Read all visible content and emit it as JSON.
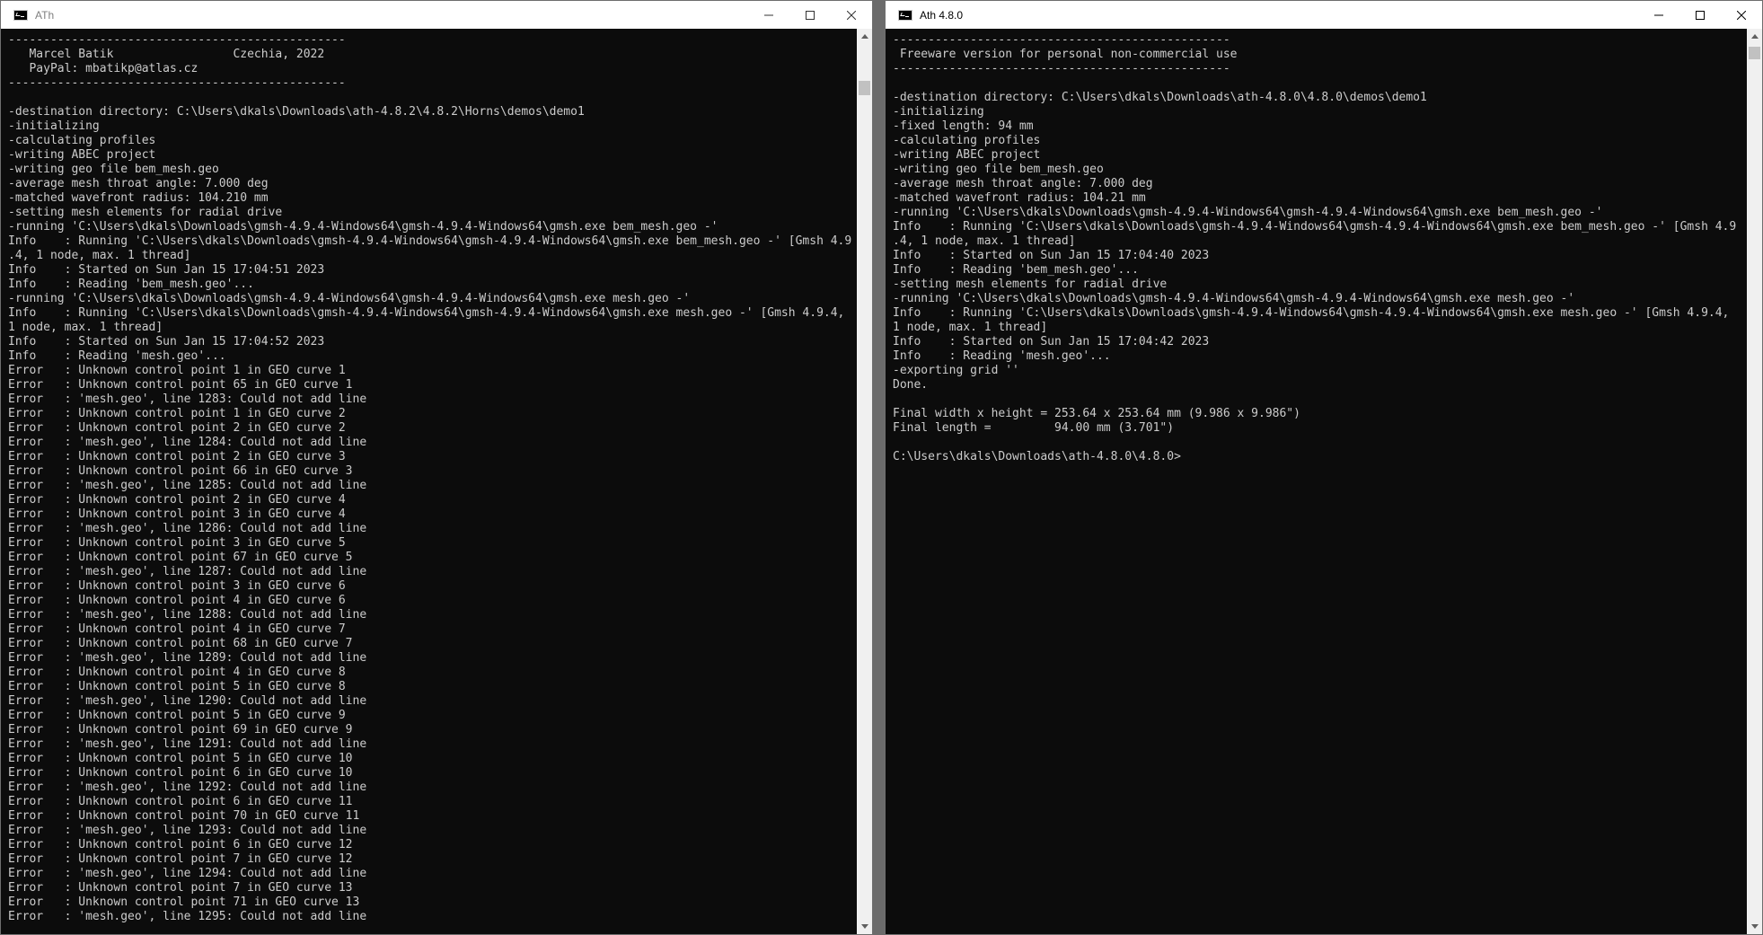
{
  "left_window": {
    "title": "ATh",
    "lines": [
      "------------------------------------------------",
      "   Marcel Batik                 Czechia, 2022",
      "   PayPal: mbatikp@atlas.cz",
      "------------------------------------------------",
      "",
      "-destination directory: C:\\Users\\dkals\\Downloads\\ath-4.8.2\\4.8.2\\Horns\\demos\\demo1",
      "-initializing",
      "-calculating profiles",
      "-writing ABEC project",
      "-writing geo file bem_mesh.geo",
      "-average mesh throat angle: 7.000 deg",
      "-matched wavefront radius: 104.210 mm",
      "-setting mesh elements for radial drive",
      "-running 'C:\\Users\\dkals\\Downloads\\gmsh-4.9.4-Windows64\\gmsh-4.9.4-Windows64\\gmsh.exe bem_mesh.geo -'",
      "Info    : Running 'C:\\Users\\dkals\\Downloads\\gmsh-4.9.4-Windows64\\gmsh-4.9.4-Windows64\\gmsh.exe bem_mesh.geo -' [Gmsh 4.9",
      ".4, 1 node, max. 1 thread]",
      "Info    : Started on Sun Jan 15 17:04:51 2023",
      "Info    : Reading 'bem_mesh.geo'...",
      "-running 'C:\\Users\\dkals\\Downloads\\gmsh-4.9.4-Windows64\\gmsh-4.9.4-Windows64\\gmsh.exe mesh.geo -'",
      "Info    : Running 'C:\\Users\\dkals\\Downloads\\gmsh-4.9.4-Windows64\\gmsh-4.9.4-Windows64\\gmsh.exe mesh.geo -' [Gmsh 4.9.4,",
      "1 node, max. 1 thread]",
      "Info    : Started on Sun Jan 15 17:04:52 2023",
      "Info    : Reading 'mesh.geo'...",
      "Error   : Unknown control point 1 in GEO curve 1",
      "Error   : Unknown control point 65 in GEO curve 1",
      "Error   : 'mesh.geo', line 1283: Could not add line",
      "Error   : Unknown control point 1 in GEO curve 2",
      "Error   : Unknown control point 2 in GEO curve 2",
      "Error   : 'mesh.geo', line 1284: Could not add line",
      "Error   : Unknown control point 2 in GEO curve 3",
      "Error   : Unknown control point 66 in GEO curve 3",
      "Error   : 'mesh.geo', line 1285: Could not add line",
      "Error   : Unknown control point 2 in GEO curve 4",
      "Error   : Unknown control point 3 in GEO curve 4",
      "Error   : 'mesh.geo', line 1286: Could not add line",
      "Error   : Unknown control point 3 in GEO curve 5",
      "Error   : Unknown control point 67 in GEO curve 5",
      "Error   : 'mesh.geo', line 1287: Could not add line",
      "Error   : Unknown control point 3 in GEO curve 6",
      "Error   : Unknown control point 4 in GEO curve 6",
      "Error   : 'mesh.geo', line 1288: Could not add line",
      "Error   : Unknown control point 4 in GEO curve 7",
      "Error   : Unknown control point 68 in GEO curve 7",
      "Error   : 'mesh.geo', line 1289: Could not add line",
      "Error   : Unknown control point 4 in GEO curve 8",
      "Error   : Unknown control point 5 in GEO curve 8",
      "Error   : 'mesh.geo', line 1290: Could not add line",
      "Error   : Unknown control point 5 in GEO curve 9",
      "Error   : Unknown control point 69 in GEO curve 9",
      "Error   : 'mesh.geo', line 1291: Could not add line",
      "Error   : Unknown control point 5 in GEO curve 10",
      "Error   : Unknown control point 6 in GEO curve 10",
      "Error   : 'mesh.geo', line 1292: Could not add line",
      "Error   : Unknown control point 6 in GEO curve 11",
      "Error   : Unknown control point 70 in GEO curve 11",
      "Error   : 'mesh.geo', line 1293: Could not add line",
      "Error   : Unknown control point 6 in GEO curve 12",
      "Error   : Unknown control point 7 in GEO curve 12",
      "Error   : 'mesh.geo', line 1294: Could not add line",
      "Error   : Unknown control point 7 in GEO curve 13",
      "Error   : Unknown control point 71 in GEO curve 13",
      "Error   : 'mesh.geo', line 1295: Could not add line"
    ]
  },
  "right_window": {
    "title": "Ath 4.8.0",
    "lines": [
      "------------------------------------------------",
      " Freeware version for personal non-commercial use",
      "------------------------------------------------",
      "",
      "-destination directory: C:\\Users\\dkals\\Downloads\\ath-4.8.0\\4.8.0\\demos\\demo1",
      "-initializing",
      "-fixed length: 94 mm",
      "-calculating profiles",
      "-writing ABEC project",
      "-writing geo file bem_mesh.geo",
      "-average mesh throat angle: 7.000 deg",
      "-matched wavefront radius: 104.21 mm",
      "-running 'C:\\Users\\dkals\\Downloads\\gmsh-4.9.4-Windows64\\gmsh-4.9.4-Windows64\\gmsh.exe bem_mesh.geo -'",
      "Info    : Running 'C:\\Users\\dkals\\Downloads\\gmsh-4.9.4-Windows64\\gmsh-4.9.4-Windows64\\gmsh.exe bem_mesh.geo -' [Gmsh 4.9",
      ".4, 1 node, max. 1 thread]",
      "Info    : Started on Sun Jan 15 17:04:40 2023",
      "Info    : Reading 'bem_mesh.geo'...",
      "-setting mesh elements for radial drive",
      "-running 'C:\\Users\\dkals\\Downloads\\gmsh-4.9.4-Windows64\\gmsh-4.9.4-Windows64\\gmsh.exe mesh.geo -'",
      "Info    : Running 'C:\\Users\\dkals\\Downloads\\gmsh-4.9.4-Windows64\\gmsh-4.9.4-Windows64\\gmsh.exe mesh.geo -' [Gmsh 4.9.4,",
      "1 node, max. 1 thread]",
      "Info    : Started on Sun Jan 15 17:04:42 2023",
      "Info    : Reading 'mesh.geo'...",
      "-exporting grid ''",
      "Done.",
      "",
      "Final width x height = 253.64 x 253.64 mm (9.986 x 9.986\")",
      "Final length =         94.00 mm (3.701\")",
      "",
      "C:\\Users\\dkals\\Downloads\\ath-4.8.0\\4.8.0>"
    ]
  }
}
